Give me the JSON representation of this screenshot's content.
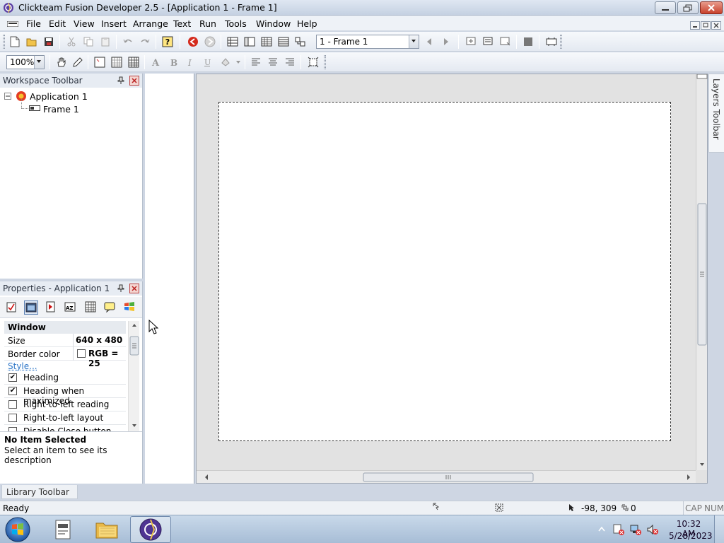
{
  "window": {
    "title": "Clickteam Fusion Developer 2.5 - [Application 1 - Frame 1]"
  },
  "menu": {
    "items": [
      "File",
      "Edit",
      "View",
      "Insert",
      "Arrange",
      "Text",
      "Run",
      "Tools",
      "Window",
      "Help"
    ]
  },
  "toolbar": {
    "frame_select": "1 - Frame 1",
    "zoom": "100%"
  },
  "workspace": {
    "title": "Workspace Toolbar",
    "tree": {
      "application": "Application 1",
      "frame": "Frame 1"
    }
  },
  "properties": {
    "title": "Properties - Application 1",
    "section": "Window",
    "rows": [
      {
        "label": "Size",
        "value": "640 x 480"
      },
      {
        "label": "Border color",
        "value": "RGB = 25"
      }
    ],
    "style_link": "Style...",
    "checks": [
      {
        "label": "Heading",
        "checked": true
      },
      {
        "label": "Heading when maximized",
        "checked": true
      },
      {
        "label": "Right-to-left reading",
        "checked": false
      },
      {
        "label": "Right-to-left layout",
        "checked": false
      },
      {
        "label": "Disable Close button",
        "checked": false
      }
    ],
    "desc_title": "No Item Selected",
    "desc_text": "Select an item to see its description"
  },
  "layers": {
    "label": "Layers Toolbar"
  },
  "library": {
    "label": "Library Toolbar"
  },
  "status": {
    "text": "Ready",
    "coords": "-98, 309",
    "count": "0",
    "caps": "CAP",
    "num": "NUM"
  },
  "taskbar": {
    "time": "10:32 AM",
    "date": "5/28/2023"
  },
  "colors": {
    "accent": "#1c5fb4",
    "frame_bg": "#ffffff",
    "editor_bg": "#e2e2e2"
  }
}
